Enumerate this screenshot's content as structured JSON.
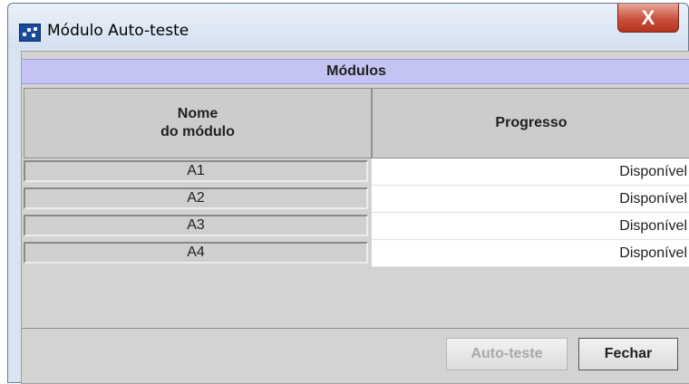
{
  "window": {
    "title": "Módulo Auto-teste",
    "close_label": "X"
  },
  "section": {
    "title": "Módulos"
  },
  "table": {
    "columns": [
      "Nome\ndo módulo",
      "Progresso"
    ],
    "rows": [
      {
        "name": "A1",
        "status": "Disponível"
      },
      {
        "name": "A2",
        "status": "Disponível"
      },
      {
        "name": "A3",
        "status": "Disponível"
      },
      {
        "name": "A4",
        "status": "Disponível"
      }
    ]
  },
  "buttons": {
    "self_test": "Auto-teste",
    "close": "Fechar"
  },
  "icons": {
    "app": "app-logo-icon",
    "close": "close-icon"
  },
  "colors": {
    "section_header_bg": "#c4c4f4",
    "close_button_bg": "#c9503a",
    "panel_bg": "#d3d3d3"
  }
}
